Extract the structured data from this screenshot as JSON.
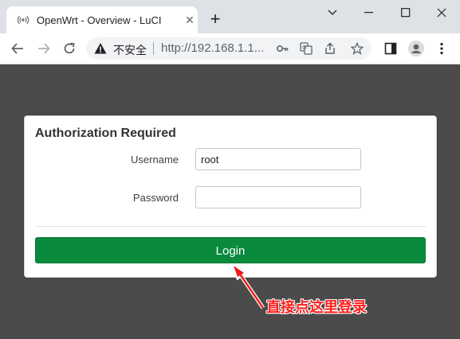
{
  "browser": {
    "tab": {
      "title": "OpenWrt - Overview - LuCI",
      "close_glyph": "✕",
      "favicon": "wifi-broadcast-icon"
    },
    "new_tab_glyph": "+",
    "window_controls": [
      "chevron-down-icon",
      "minimize-icon",
      "maximize-icon",
      "close-icon"
    ],
    "nav": [
      "back-icon",
      "forward-icon",
      "reload-icon"
    ],
    "omnibox": {
      "security_label": "不安全",
      "url": "http://192.168.1.1...",
      "icons": [
        "key-icon",
        "translate-icon",
        "share-icon",
        "star-icon"
      ]
    },
    "toolbar_icons": [
      "sidepanel-icon",
      "profile-icon",
      "menu-icon"
    ]
  },
  "login": {
    "title": "Authorization Required",
    "username_label": "Username",
    "username_value": "root",
    "password_label": "Password",
    "password_value": "",
    "submit_label": "Login"
  },
  "annotation": {
    "text": "直接点这里登录",
    "color": "#ff2020"
  },
  "colors": {
    "page_bg": "#4b4b4b",
    "login_button": "#0a8a3c",
    "tabstrip": "#dee1e6"
  }
}
